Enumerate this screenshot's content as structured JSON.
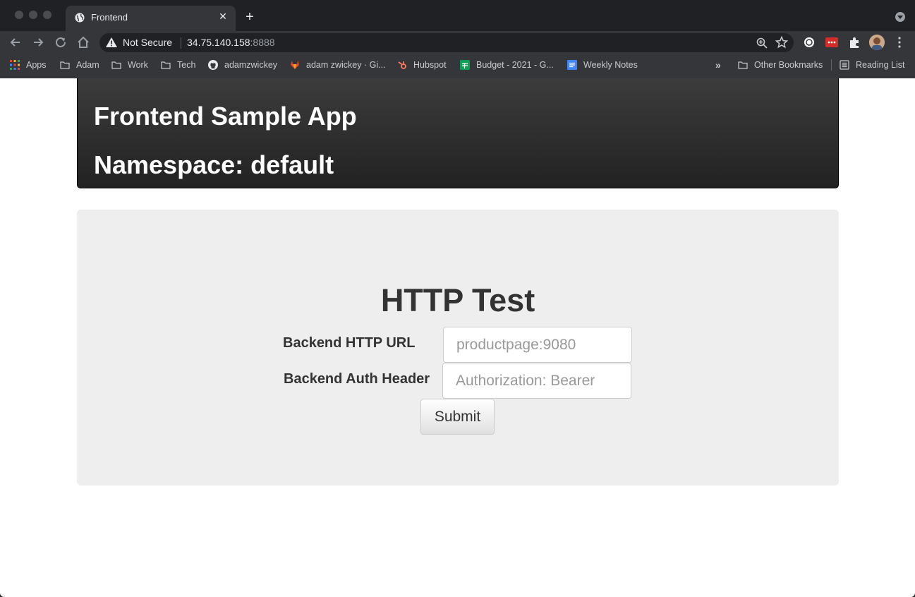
{
  "browser": {
    "tab": {
      "title": "Frontend",
      "close": "✕"
    },
    "new_tab": "+",
    "address": {
      "security_label": "Not Secure",
      "host": "34.75.140.158",
      "port": ":8888"
    },
    "bookmarks": [
      {
        "label": "Apps",
        "icon": "apps-grid-icon"
      },
      {
        "label": "Adam",
        "icon": "folder-icon"
      },
      {
        "label": "Work",
        "icon": "folder-icon"
      },
      {
        "label": "Tech",
        "icon": "folder-icon"
      },
      {
        "label": "adamzwickey",
        "icon": "github-icon"
      },
      {
        "label": "adam zwickey · Gi...",
        "icon": "gitlab-icon"
      },
      {
        "label": "Hubspot",
        "icon": "hubspot-icon"
      },
      {
        "label": "Budget - 2021 - G...",
        "icon": "sheets-icon"
      },
      {
        "label": "Weekly Notes",
        "icon": "docs-icon"
      }
    ],
    "overflow": "»",
    "other_bookmarks": "Other Bookmarks",
    "reading_list": "Reading List"
  },
  "header": {
    "title": "Frontend Sample App",
    "namespace": "Namespace: default"
  },
  "form": {
    "heading": "HTTP Test",
    "url_label": "Backend HTTP URL",
    "url_placeholder": "productpage:9080",
    "auth_label": "Backend Auth Header",
    "auth_placeholder": "Authorization: Bearer",
    "submit_label": "Submit"
  },
  "colors": {
    "banner_top": "#3c3c3c",
    "banner_bottom": "#222222",
    "well_background": "#eeeeee",
    "chrome_dark": "#202124",
    "chrome_toolbar": "#35363a"
  }
}
